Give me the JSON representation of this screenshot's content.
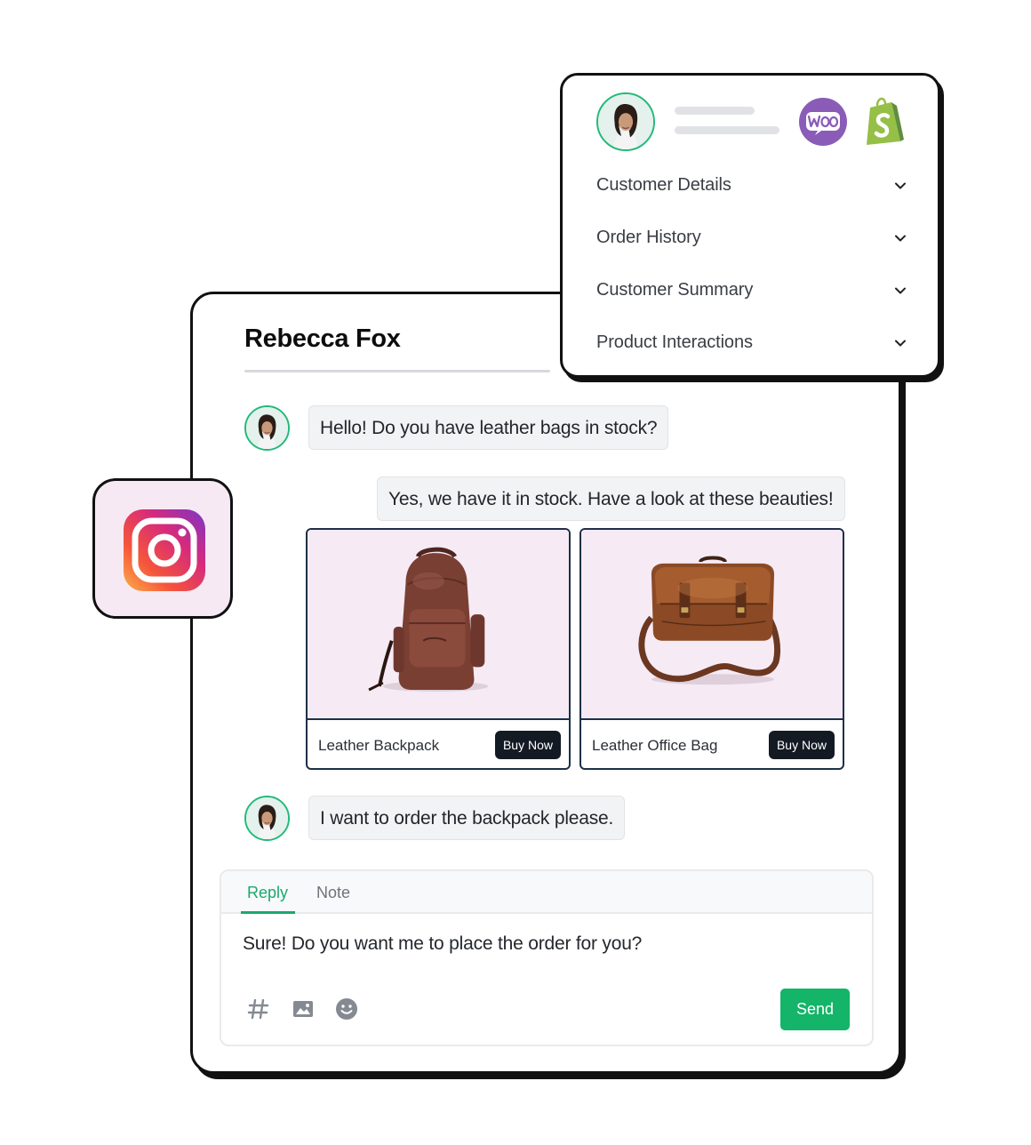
{
  "conversation": {
    "contact_name": "Rebecca Fox",
    "messages": [
      {
        "sender": "customer",
        "text": "Hello! Do you have leather bags in stock?"
      },
      {
        "sender": "agent",
        "text": "Yes, we have it in stock. Have a look at these beauties!"
      },
      {
        "sender": "customer",
        "text": "I want to order the backpack please."
      }
    ],
    "products": [
      {
        "name": "Leather Backpack",
        "button_label": "Buy Now",
        "icon": "backpack-image"
      },
      {
        "name": "Leather Office Bag",
        "button_label": "Buy Now",
        "icon": "office-bag-image"
      }
    ]
  },
  "composer": {
    "tabs": [
      {
        "label": "Reply",
        "active": true
      },
      {
        "label": "Note",
        "active": false
      }
    ],
    "draft_text": "Sure! Do you want me to place the order for you?",
    "tools": [
      "hashtag-icon",
      "image-icon",
      "emoji-icon"
    ],
    "send_label": "Send"
  },
  "customer_panel": {
    "integrations": [
      "woocommerce-logo",
      "shopify-logo"
    ],
    "sections": [
      {
        "label": "Customer Details"
      },
      {
        "label": "Order History"
      },
      {
        "label": "Customer Summary"
      },
      {
        "label": "Product Interactions"
      }
    ]
  },
  "channel": {
    "icon": "instagram-icon"
  },
  "colors": {
    "accent_green": "#14b469",
    "reply_tab_green": "#1ba86d",
    "avatar_ring": "#23b97a",
    "product_background": "#f6eaf4",
    "woo_purple": "#8a5cb8",
    "shopify_green": "#95bf47",
    "buy_button": "#141a24"
  }
}
